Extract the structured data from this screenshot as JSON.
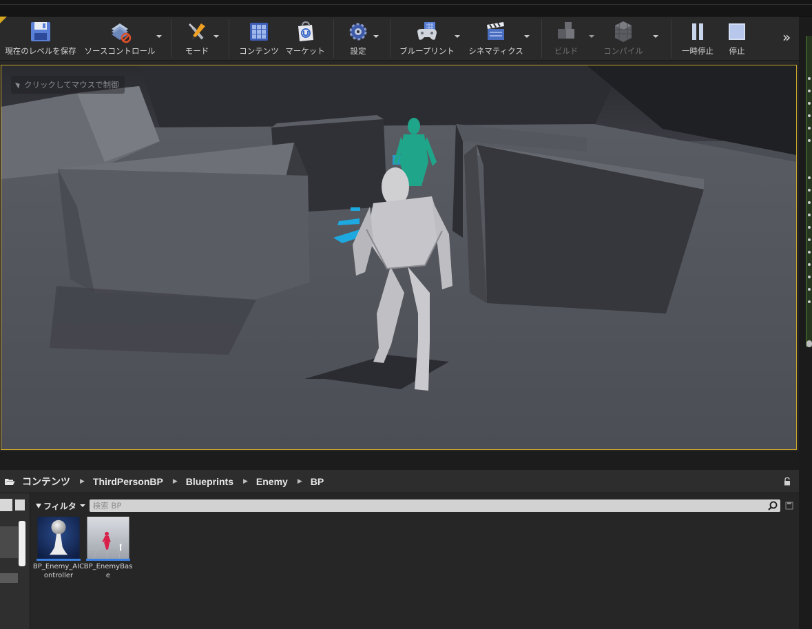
{
  "toolbar": {
    "items": [
      {
        "label": "現在のレベルを保存",
        "icon": "save-icon",
        "enabled": true
      },
      {
        "label": "ソースコントロール",
        "icon": "source-control-icon",
        "enabled": true,
        "dropdown": true
      },
      {
        "label": "モード",
        "icon": "modes-icon",
        "enabled": true,
        "dropdown": true
      },
      {
        "label": "コンテンツ",
        "icon": "content-icon",
        "enabled": true
      },
      {
        "label": "マーケット",
        "icon": "marketplace-icon",
        "enabled": true
      },
      {
        "label": "設定",
        "icon": "settings-icon",
        "enabled": true,
        "dropdown": true
      },
      {
        "label": "ブループリント",
        "icon": "blueprint-icon",
        "enabled": true,
        "dropdown": true
      },
      {
        "label": "シネマティクス",
        "icon": "cinematics-icon",
        "enabled": true,
        "dropdown": true
      },
      {
        "label": "ビルド",
        "icon": "build-icon",
        "enabled": false,
        "dropdown": true
      },
      {
        "label": "コンパイル",
        "icon": "compile-icon",
        "enabled": false,
        "dropdown": true
      },
      {
        "label": "一時停止",
        "icon": "pause-icon",
        "enabled": true
      },
      {
        "label": "停止",
        "icon": "stop-icon",
        "enabled": true
      }
    ],
    "overflow": "»"
  },
  "viewport": {
    "click_hint": "クリックしてマウスで制御"
  },
  "content_browser": {
    "breadcrumb": [
      "コンテンツ",
      "ThirdPersonBP",
      "Blueprints",
      "Enemy",
      "BP"
    ],
    "filter_label": "フィルタ",
    "search_placeholder": "検索 BP",
    "assets": [
      {
        "name": "BP_Enemy_AIController",
        "thumbnail": "ai-controller-pawn-icon"
      },
      {
        "name": "BP_EnemyBase",
        "thumbnail": "character-blueprint-thumbnail"
      }
    ]
  },
  "colors": {
    "accent": "#d7a722",
    "selection": "#3a80e0",
    "enemy_mannequin": "#1fa68a",
    "player_mannequin": "#c9c9cc"
  }
}
